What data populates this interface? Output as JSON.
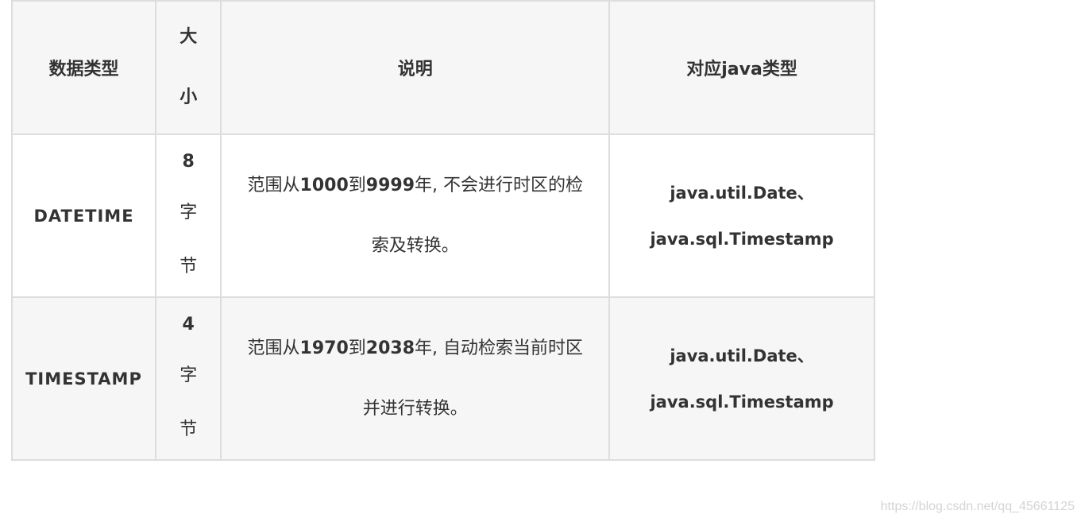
{
  "table": {
    "headers": {
      "type": "数据类型",
      "size": "大小",
      "desc": "说明",
      "java": "对应java类型"
    },
    "rows": [
      {
        "type": "DATETIME",
        "size_num": "8",
        "size_unit_1": "字",
        "size_unit_2": "节",
        "desc_1": "范围从",
        "desc_2": "1000",
        "desc_3": "到",
        "desc_4": "9999",
        "desc_5": "年, 不会进行时区的检索及转换。",
        "java_1": "java.util.Date、",
        "java_2": "java.sql.Timestamp"
      },
      {
        "type": "TIMESTAMP",
        "size_num": "4",
        "size_unit_1": "字",
        "size_unit_2": "节",
        "desc_1": "范围从",
        "desc_2": "1970",
        "desc_3": "到",
        "desc_4": "2038",
        "desc_5": "年, 自动检索当前时区并进行转换。",
        "java_1": "java.util.Date、",
        "java_2": "java.sql.Timestamp"
      }
    ]
  },
  "watermark": "https://blog.csdn.net/qq_45661125"
}
